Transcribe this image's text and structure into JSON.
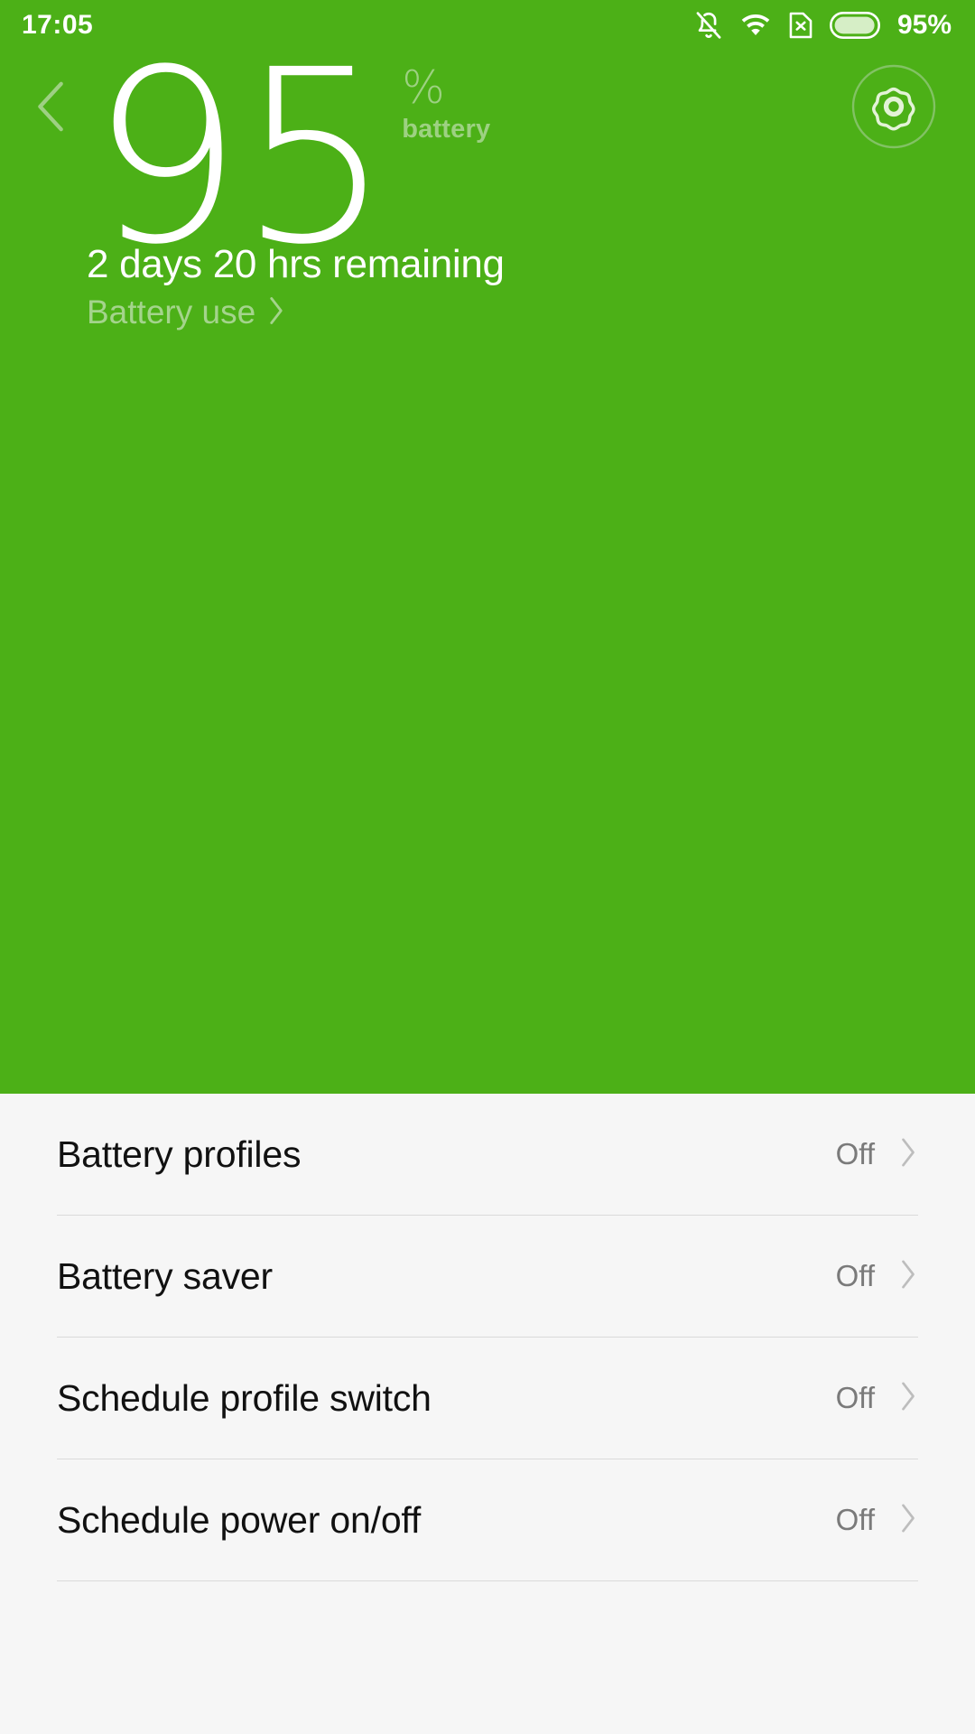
{
  "theme": {
    "hero_green": "#4cb017",
    "hero_green_light": "#9dd182",
    "list_bg": "#f6f6f6",
    "divider": "#dadada",
    "value_gray": "#7a7a7a",
    "chevron_gray": "#bdbdbd"
  },
  "status_bar": {
    "time": "17:05",
    "battery_percent": "95%",
    "icons": [
      "bell-off-icon",
      "wifi-icon",
      "sim-card-no-service-icon",
      "battery-icon"
    ]
  },
  "header": {
    "back_icon": "chevron-left-icon",
    "settings_icon": "gear-icon",
    "battery_level": "95",
    "percent_symbol": "%",
    "battery_word": "battery",
    "remaining_text": "2 days 20 hrs remaining",
    "battery_use_label": "Battery use",
    "battery_use_chevron": "chevron-right-icon"
  },
  "settings_list": {
    "rows": [
      {
        "label": "Battery profiles",
        "value": "Off",
        "chevron": "chevron-right-icon"
      },
      {
        "label": "Battery saver",
        "value": "Off",
        "chevron": "chevron-right-icon"
      },
      {
        "label": "Schedule profile switch",
        "value": "Off",
        "chevron": "chevron-right-icon"
      },
      {
        "label": "Schedule power on/off",
        "value": "Off",
        "chevron": "chevron-right-icon"
      }
    ]
  }
}
